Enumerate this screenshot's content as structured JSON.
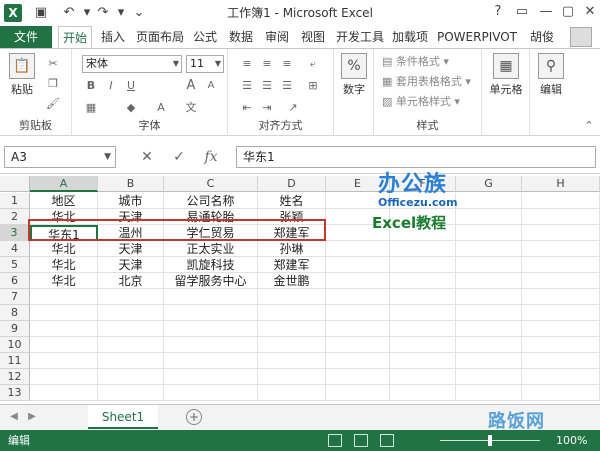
{
  "window": {
    "title": "工作簿1 - Microsoft Excel",
    "app_badge": "X",
    "accent_color": "#217346",
    "controls": [
      "?",
      "▭",
      "—",
      "▢",
      "✕"
    ]
  },
  "tabs": {
    "file": "文件",
    "items": [
      "开始",
      "插入",
      "页面布局",
      "公式",
      "数据",
      "审阅",
      "视图",
      "开发工具",
      "加载项",
      "POWERPIVOT"
    ],
    "active": "开始",
    "user": "胡俊"
  },
  "ribbon": {
    "clipboard": {
      "paste": "粘贴",
      "label": "剪贴板"
    },
    "font": {
      "name": "宋体",
      "size": "11",
      "bold": "B",
      "italic": "I",
      "underline": "U",
      "grow": "A",
      "shrink": "A",
      "label": "字体"
    },
    "alignment": {
      "label": "对齐方式"
    },
    "number": {
      "button": "数字",
      "symbol": "%"
    },
    "styles": {
      "conditional": "条件格式",
      "table": "套用表格格式",
      "cell": "单元格样式",
      "label": "样式"
    },
    "cells": {
      "button": "单元格"
    },
    "editing": {
      "button": "编辑"
    }
  },
  "formula_bar": {
    "name_box": "A3",
    "cancel": "✕",
    "enter": "✓",
    "fx": "fx",
    "value": "华东1"
  },
  "grid": {
    "columns": [
      "A",
      "B",
      "C",
      "D",
      "E",
      "F",
      "G",
      "H"
    ],
    "selected_column": "A",
    "rows": [
      "1",
      "2",
      "3",
      "4",
      "5",
      "6",
      "7",
      "8",
      "9",
      "10",
      "11",
      "12",
      "13"
    ],
    "selected_row": "3",
    "cells": [
      [
        "地区",
        "城市",
        "公司名称",
        "姓名"
      ],
      [
        "华北",
        "天津",
        "易通轮胎",
        "张颖"
      ],
      [
        "华东1",
        "温州",
        "学仁贸易",
        "郑建军"
      ],
      [
        "华北",
        "天津",
        "正太实业",
        "孙琳"
      ],
      [
        "华北",
        "天津",
        "凯旋科技",
        "郑建军"
      ],
      [
        "华北",
        "北京",
        "留学服务中心",
        "金世鹏"
      ]
    ],
    "highlight_color": "#c0392b"
  },
  "watermark": {
    "brand": "办公族",
    "site": "Officezu.com",
    "course": "Excel教程",
    "footer_site": "路饭网"
  },
  "sheets": {
    "items": [
      "Sheet1"
    ],
    "active": "Sheet1",
    "add": "+"
  },
  "status": {
    "mode": "编辑",
    "zoom": "100%"
  }
}
